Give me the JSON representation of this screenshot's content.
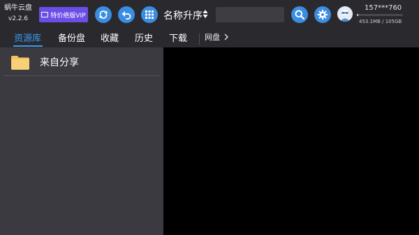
{
  "app": {
    "title": "蜗牛云盘",
    "version": "v2.2.6"
  },
  "toolbar": {
    "vip_label": "特价绝版VIP",
    "refresh_icon": "refresh-icon",
    "back_icon": "undo-arrow-icon",
    "grid_icon": "grid-view-icon",
    "sort_label": "名称升序",
    "search": {
      "value": "",
      "placeholder": ""
    },
    "search_icon": "search-icon",
    "settings_icon": "gear-icon"
  },
  "user": {
    "name": "157***760",
    "storage_text": "453.1MB / 105GB",
    "storage_fraction": 0.0043
  },
  "tabs": [
    {
      "label": "资源库",
      "active": true
    },
    {
      "label": "备份盘",
      "active": false
    },
    {
      "label": "收藏",
      "active": false
    },
    {
      "label": "历史",
      "active": false
    },
    {
      "label": "下载",
      "active": false
    }
  ],
  "breadcrumb": {
    "label": "网盘"
  },
  "folders": [
    {
      "label": "来自分享",
      "icon": "folder-icon"
    }
  ],
  "colors": {
    "accent": "#3a9af0",
    "vip": "#6b4ee6",
    "button": "#3a8de0",
    "folder": "#f5c060"
  }
}
